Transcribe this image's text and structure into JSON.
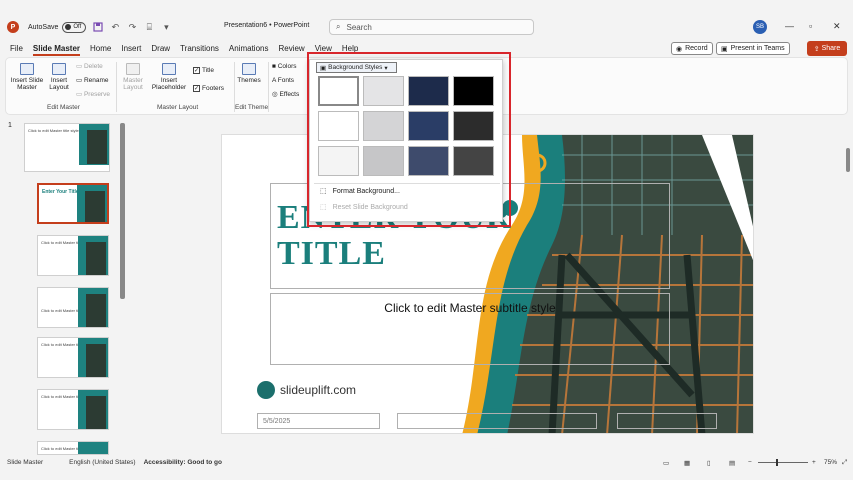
{
  "titlebar": {
    "app_icon": "P",
    "autosave_label": "AutoSave",
    "autosave_state": "Off",
    "title": "Presentation6 • PowerPoint",
    "search_placeholder": "Search",
    "user_initials": "SB"
  },
  "tabs": [
    "File",
    "Slide Master",
    "Home",
    "Insert",
    "Draw",
    "Transitions",
    "Animations",
    "Review",
    "View",
    "Help"
  ],
  "actions": {
    "record": "Record",
    "present_in_teams": "Present in Teams",
    "share": "Share"
  },
  "ribbon": {
    "insert_slide_master": "Insert Slide Master",
    "insert_layout": "Insert Layout",
    "delete": "Delete",
    "rename": "Rename",
    "preserve": "Preserve",
    "edit_master_label": "Edit Master",
    "master_layout": "Master Layout",
    "insert_placeholder": "Insert Placeholder",
    "title_check": "Title",
    "footers_check": "Footers",
    "master_layout_label": "Master Layout",
    "themes": "Themes",
    "edit_theme_label": "Edit Theme",
    "colors": "Colors",
    "fonts": "Fonts",
    "effects": "Effects"
  },
  "background_styles": {
    "button_label": "Background Styles",
    "swatch_colors": [
      "#ffffff",
      "#e4e4e6",
      "#1d2b4b",
      "#000000",
      "#ffffff",
      "#d4d4d6",
      "#2a3d66",
      "#2c2c2c",
      "#f4f4f4",
      "#c6c6c8",
      "#3e4b6c",
      "#444444"
    ],
    "format_background": "Format Background...",
    "reset_slide_background": "Reset Slide Background"
  },
  "slide_number": "1",
  "slide": {
    "title": "Enter Your Title",
    "subtitle": "Click to edit Master subtitle style",
    "brand": "slideuplift.com",
    "date": "5/5/2025"
  },
  "thumbnails": [
    {
      "caption": "Click to edit Master title style"
    },
    {
      "caption": "Enter Your Title"
    },
    {
      "caption": "Click to edit Master title style"
    },
    {
      "caption": "Click to edit Master title style"
    },
    {
      "caption": "Click to edit Master title style"
    },
    {
      "caption": "Click to edit Master title style"
    },
    {
      "caption": "Click to edit Master title style"
    }
  ],
  "statusbar": {
    "view": "Slide Master",
    "language": "English (United States)",
    "accessibility": "Accessibility: Good to go",
    "zoom": "75%"
  },
  "colors": {
    "accent": "#c43e1c",
    "teal": "#1b7f7c",
    "highlight_box": "#d8262c"
  }
}
